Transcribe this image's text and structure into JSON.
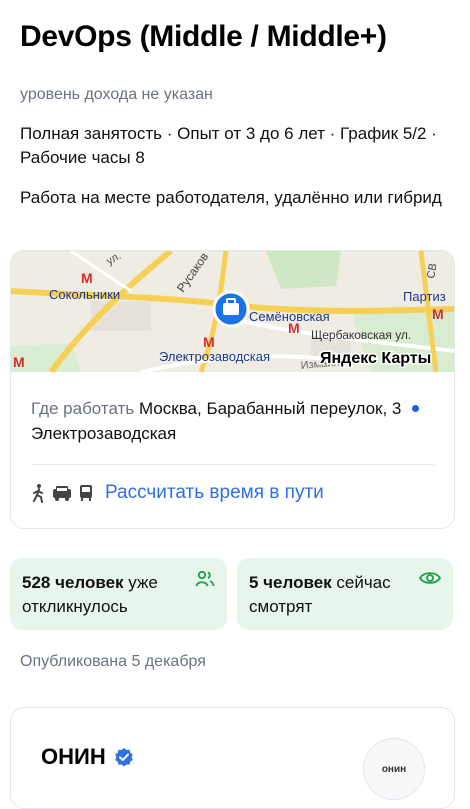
{
  "vacancy": {
    "title": "DevOps (Middle / Middle+)",
    "income": "уровень дохода не указан",
    "details": "Полная занятость · Опыт от 3 до 6 лет · График 5/2 · Рабочие часы 8",
    "work_format": "Работа на месте работодателя, удалённо или гибрид"
  },
  "map": {
    "labels": {
      "sokolniki": "Сокольники",
      "semenovskaya": "Семёновская",
      "shcherbakovskaya": "Щербаковская ул.",
      "elektrozavodskaya": "Электрозаводская",
      "partizanskaya": "Партиз",
      "rusakovskaya": "Русаков",
      "street_ul": "ул.",
      "street_sv": "СВ",
      "izmailovskoe": "Измайловск"
    },
    "provider": "Яндекс Карты",
    "colors": {
      "metro": "#d32f2f",
      "pin": "#1a73e8"
    }
  },
  "address": {
    "label": "Где работать",
    "value": "Москва, Барабанный переулок, 3",
    "metro": "Электрозаводская",
    "metro_color": "#1a5fe0"
  },
  "route": {
    "icons": [
      "walk-icon",
      "car-icon",
      "bus-icon"
    ],
    "link": "Рассчитать время в пути"
  },
  "stats": {
    "responded_count": "528 человек",
    "responded_text": "уже откликнулось",
    "viewing_count": "5 человек",
    "viewing_text": "сейчас смотрят",
    "accent": "#1e9e4a"
  },
  "published": "Опубликована 5 декабря",
  "employer": {
    "name": "ОНИН",
    "logo_text": "онин",
    "verified_icon": "verified-badge-icon"
  }
}
